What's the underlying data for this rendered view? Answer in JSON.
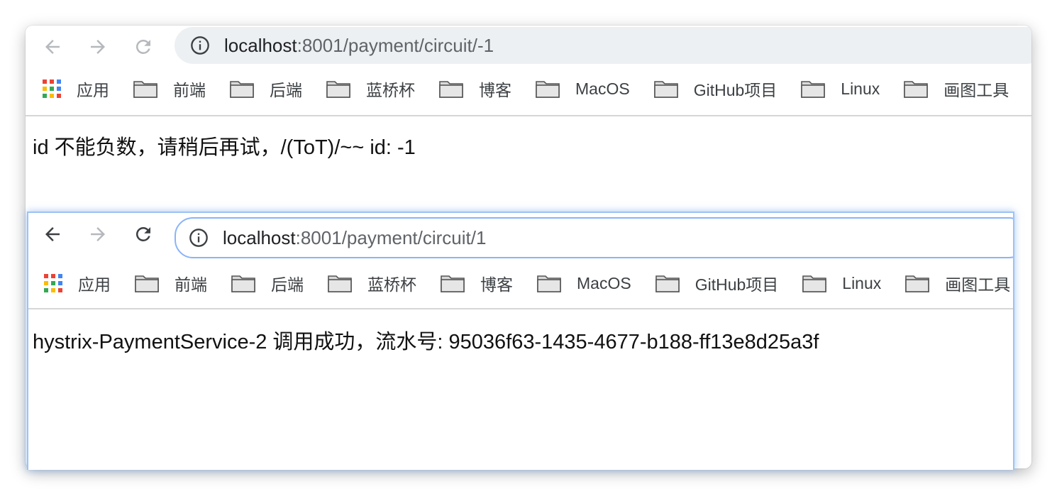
{
  "windows": [
    {
      "url_host": "localhost",
      "url_path": ":8001/payment/circuit/-1",
      "page_text": "id 不能负数，请稍后再试，/(ToT)/~~ id: -1"
    },
    {
      "url_host": "localhost",
      "url_path": ":8001/payment/circuit/1",
      "page_text": "hystrix-PaymentService-2 调用成功，流水号: 95036f63-1435-4677-b188-ff13e8d25a3f"
    }
  ],
  "bookmarks": {
    "apps_label": "应用",
    "folders": [
      "前端",
      "后端",
      "蓝桥杯",
      "博客",
      "MacOS",
      "GitHub项目",
      "Linux",
      "画图工具",
      ""
    ]
  },
  "icons": [
    "back-arrow-icon",
    "forward-arrow-icon",
    "reload-icon",
    "info-icon",
    "apps-grid-icon",
    "folder-icon"
  ],
  "colors": {
    "focus_ring": "#8ab4f8",
    "omnibox_bg": "#edf0f2"
  }
}
